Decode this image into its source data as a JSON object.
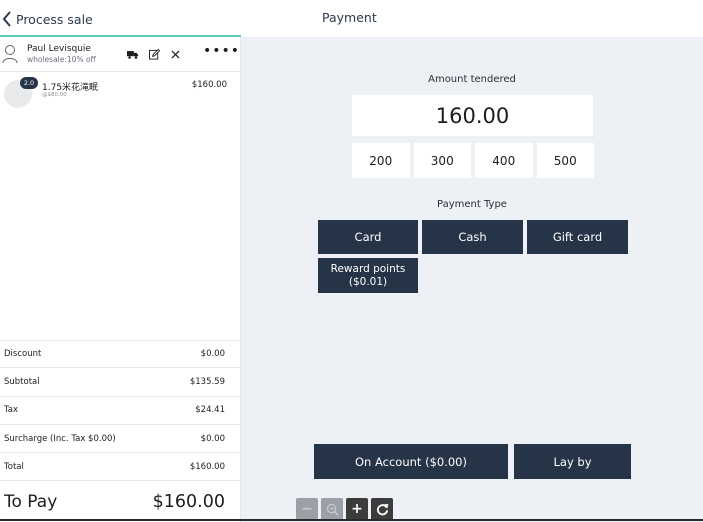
{
  "header": {
    "back_label": "Process sale",
    "title": "Payment"
  },
  "customer": {
    "name": "Paul Levisquie",
    "pricing": "wholesale:10% off",
    "more": "••••"
  },
  "line_items": [
    {
      "qty": "2.0",
      "name": "1.75米花滝眠",
      "sub": "@$80.00",
      "price": "$160.00"
    }
  ],
  "summary": [
    {
      "label": "Discount",
      "value": "$0.00"
    },
    {
      "label": "Subtotal",
      "value": "$135.59"
    },
    {
      "label": "Tax",
      "value": "$24.41"
    },
    {
      "label": "Surcharge (Inc. Tax $0.00)",
      "value": "$0.00"
    },
    {
      "label": "Total",
      "value": "$160.00"
    }
  ],
  "to_pay": {
    "label": "To Pay",
    "value": "$160.00"
  },
  "tender": {
    "label": "Amount tendered",
    "value": "160.00",
    "quick_amounts": [
      "200",
      "300",
      "400",
      "500"
    ]
  },
  "payment_type": {
    "label": "Payment Type",
    "card": "Card",
    "cash": "Cash",
    "gift_card": "Gift card",
    "reward_line1": "Reward points",
    "reward_line2": "($0.01)"
  },
  "actions": {
    "on_account": "On Account ($0.00)",
    "lay_by": "Lay by"
  },
  "zoom": {
    "minus": "−",
    "plus": "+"
  },
  "colors": {
    "accent": "#5ec9bd",
    "button_dark": "#253447",
    "panel_bg": "#edf0f4"
  }
}
